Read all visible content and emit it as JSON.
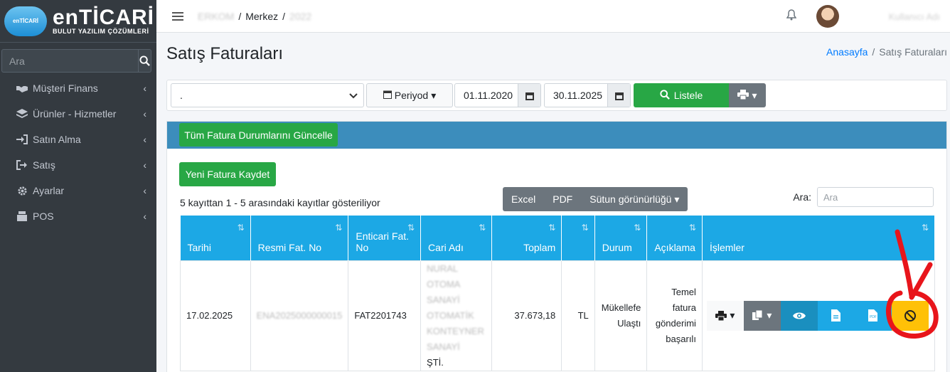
{
  "sidebar": {
    "brand_badge": "enTİCARİ",
    "brand_title": "enTİCARİ",
    "brand_sub": "BULUT YAZILIM ÇÖZÜMLERİ",
    "search_placeholder": "Ara",
    "items": [
      {
        "label": "Müşteri Finans",
        "icon": "handshake-icon"
      },
      {
        "label": "Ürünler - Hizmetler",
        "icon": "layers-icon"
      },
      {
        "label": "Satın Alma",
        "icon": "sign-in-icon"
      },
      {
        "label": "Satış",
        "icon": "sign-out-icon"
      },
      {
        "label": "Ayarlar",
        "icon": "gear-icon"
      },
      {
        "label": "POS",
        "icon": "cash-register-icon"
      }
    ]
  },
  "navbar": {
    "crumb_blur_1": "ERKOM",
    "crumb_mid": "Merkez",
    "crumb_blur_2": "2022",
    "user_name": "Kullanıcı Adı"
  },
  "page": {
    "title": "Satış Faturaları",
    "breadcrumb_home": "Anasayfa",
    "breadcrumb_current": "Satış Faturaları"
  },
  "filter": {
    "select_value": ".",
    "period_label": "Periyod",
    "date_start": "01.11.2020",
    "date_end": "30.11.2025",
    "list_label": "Listele"
  },
  "card": {
    "update_all_label": "Tüm Fatura Durumlarını Güncelle",
    "new_invoice_label": "Yeni Fatura Kaydet",
    "info": "5 kayıttan 1 - 5 arasındaki kayıtlar gösteriliyor",
    "excel_label": "Excel",
    "pdf_label": "PDF",
    "columns_label": "Sütun görünürlüğü",
    "search_label": "Ara:",
    "search_placeholder": "Ara"
  },
  "table": {
    "headers": [
      "Tarihi",
      "Resmi Fat. No",
      "Enticari Fat. No",
      "Cari Adı",
      "Toplam",
      "",
      "Durum",
      "Açıklama",
      "İşlemler"
    ],
    "row": {
      "date": "17.02.2025",
      "official_no": "ENA2025000000015",
      "enticari_no": "FAT2201743",
      "cari_lines": [
        "NURAL",
        "OTOMA",
        "SANAYİ",
        "OTOMATİK",
        "KONTEYNER",
        "SANAYİ",
        "ŞTİ."
      ],
      "total": "37.673,18",
      "currency": "TL",
      "status": "Mükellefe Ulaştı",
      "description": "Temel fatura gönderimi başarılı",
      "pdf_badge": "PDF"
    }
  },
  "colors": {
    "sidebar_bg": "#343a40",
    "header_blue": "#1ca8e5",
    "success_green": "#28a745",
    "secondary_gray": "#6c757d",
    "warning_yellow": "#ffc107",
    "annotation_red": "#e8151b"
  }
}
